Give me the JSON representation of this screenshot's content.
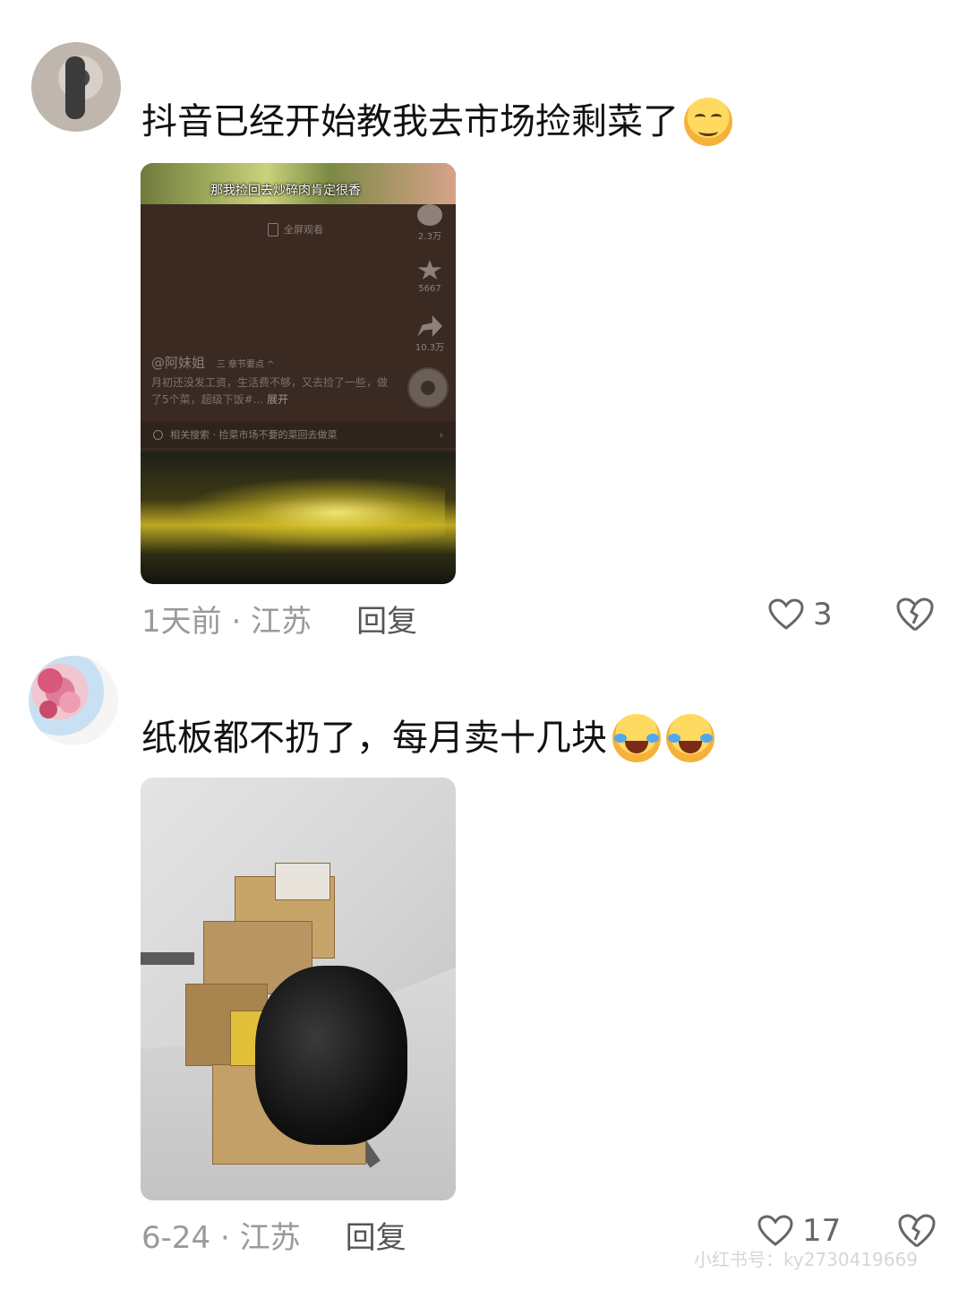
{
  "comments": [
    {
      "text": "抖音已经开始教我去市场捡剩菜了",
      "emoji": [
        "smug-face-emoji"
      ],
      "image": {
        "caption": "那我捡回去炒碎肉肯定很香",
        "fullscreen_label": "全屏观看",
        "stats": [
          {
            "icon": "comment-icon",
            "count": "2.3万"
          },
          {
            "icon": "star-icon",
            "count": "5667"
          },
          {
            "icon": "share-icon",
            "count": "10.3万"
          }
        ],
        "user": "@阿妹姐",
        "user_tag": "三 章节要点 ^",
        "description": "月初还没发工资，生活费不够，又去捡了一些，做了5个菜，超级下饭#...",
        "expand": "展开",
        "search": "相关搜索 · 捡菜市场不要的菜回去做菜",
        "search_arrow": "›"
      },
      "time": "1天前 · 江苏",
      "reply": "回复",
      "likes": "3"
    },
    {
      "text": "纸板都不扔了，每月卖十几块",
      "emoji": [
        "tears-of-joy-emoji",
        "tears-of-joy-emoji"
      ],
      "time": "6-24 · 江苏",
      "reply": "回复",
      "likes": "17"
    }
  ],
  "watermark": "小红书号：ky2730419669",
  "colors": {
    "text": "#111111",
    "meta": "#9a9a9a",
    "reply": "#555555"
  }
}
